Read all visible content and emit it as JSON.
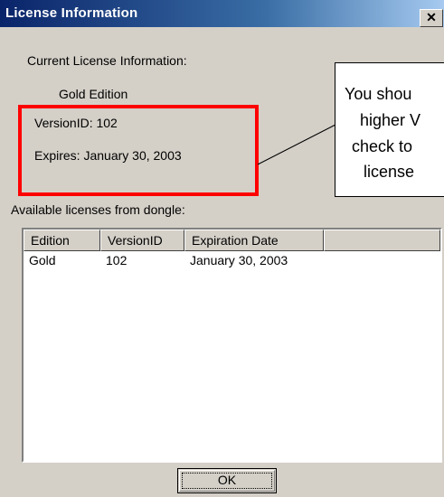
{
  "window": {
    "title": "License Information",
    "close_glyph": "✕"
  },
  "current": {
    "heading": "Current License Information:",
    "edition": "Gold Edition",
    "version": "VersionID: 102",
    "expires": "Expires: January 30, 2003"
  },
  "callout": {
    "lines": [
      "You shou",
      "higher V",
      "check to",
      "license"
    ]
  },
  "available": {
    "heading": "Available licenses from dongle:",
    "columns": [
      "Edition",
      "VersionID",
      "Expiration Date"
    ],
    "rows": [
      [
        "Gold",
        "102",
        "January 30, 2003"
      ]
    ]
  },
  "buttons": {
    "ok_label": "OK"
  },
  "colors": {
    "highlight_border": "#ff0000",
    "titlebar_start": "#0a246a",
    "dialog_bg": "#d4d0c8"
  }
}
